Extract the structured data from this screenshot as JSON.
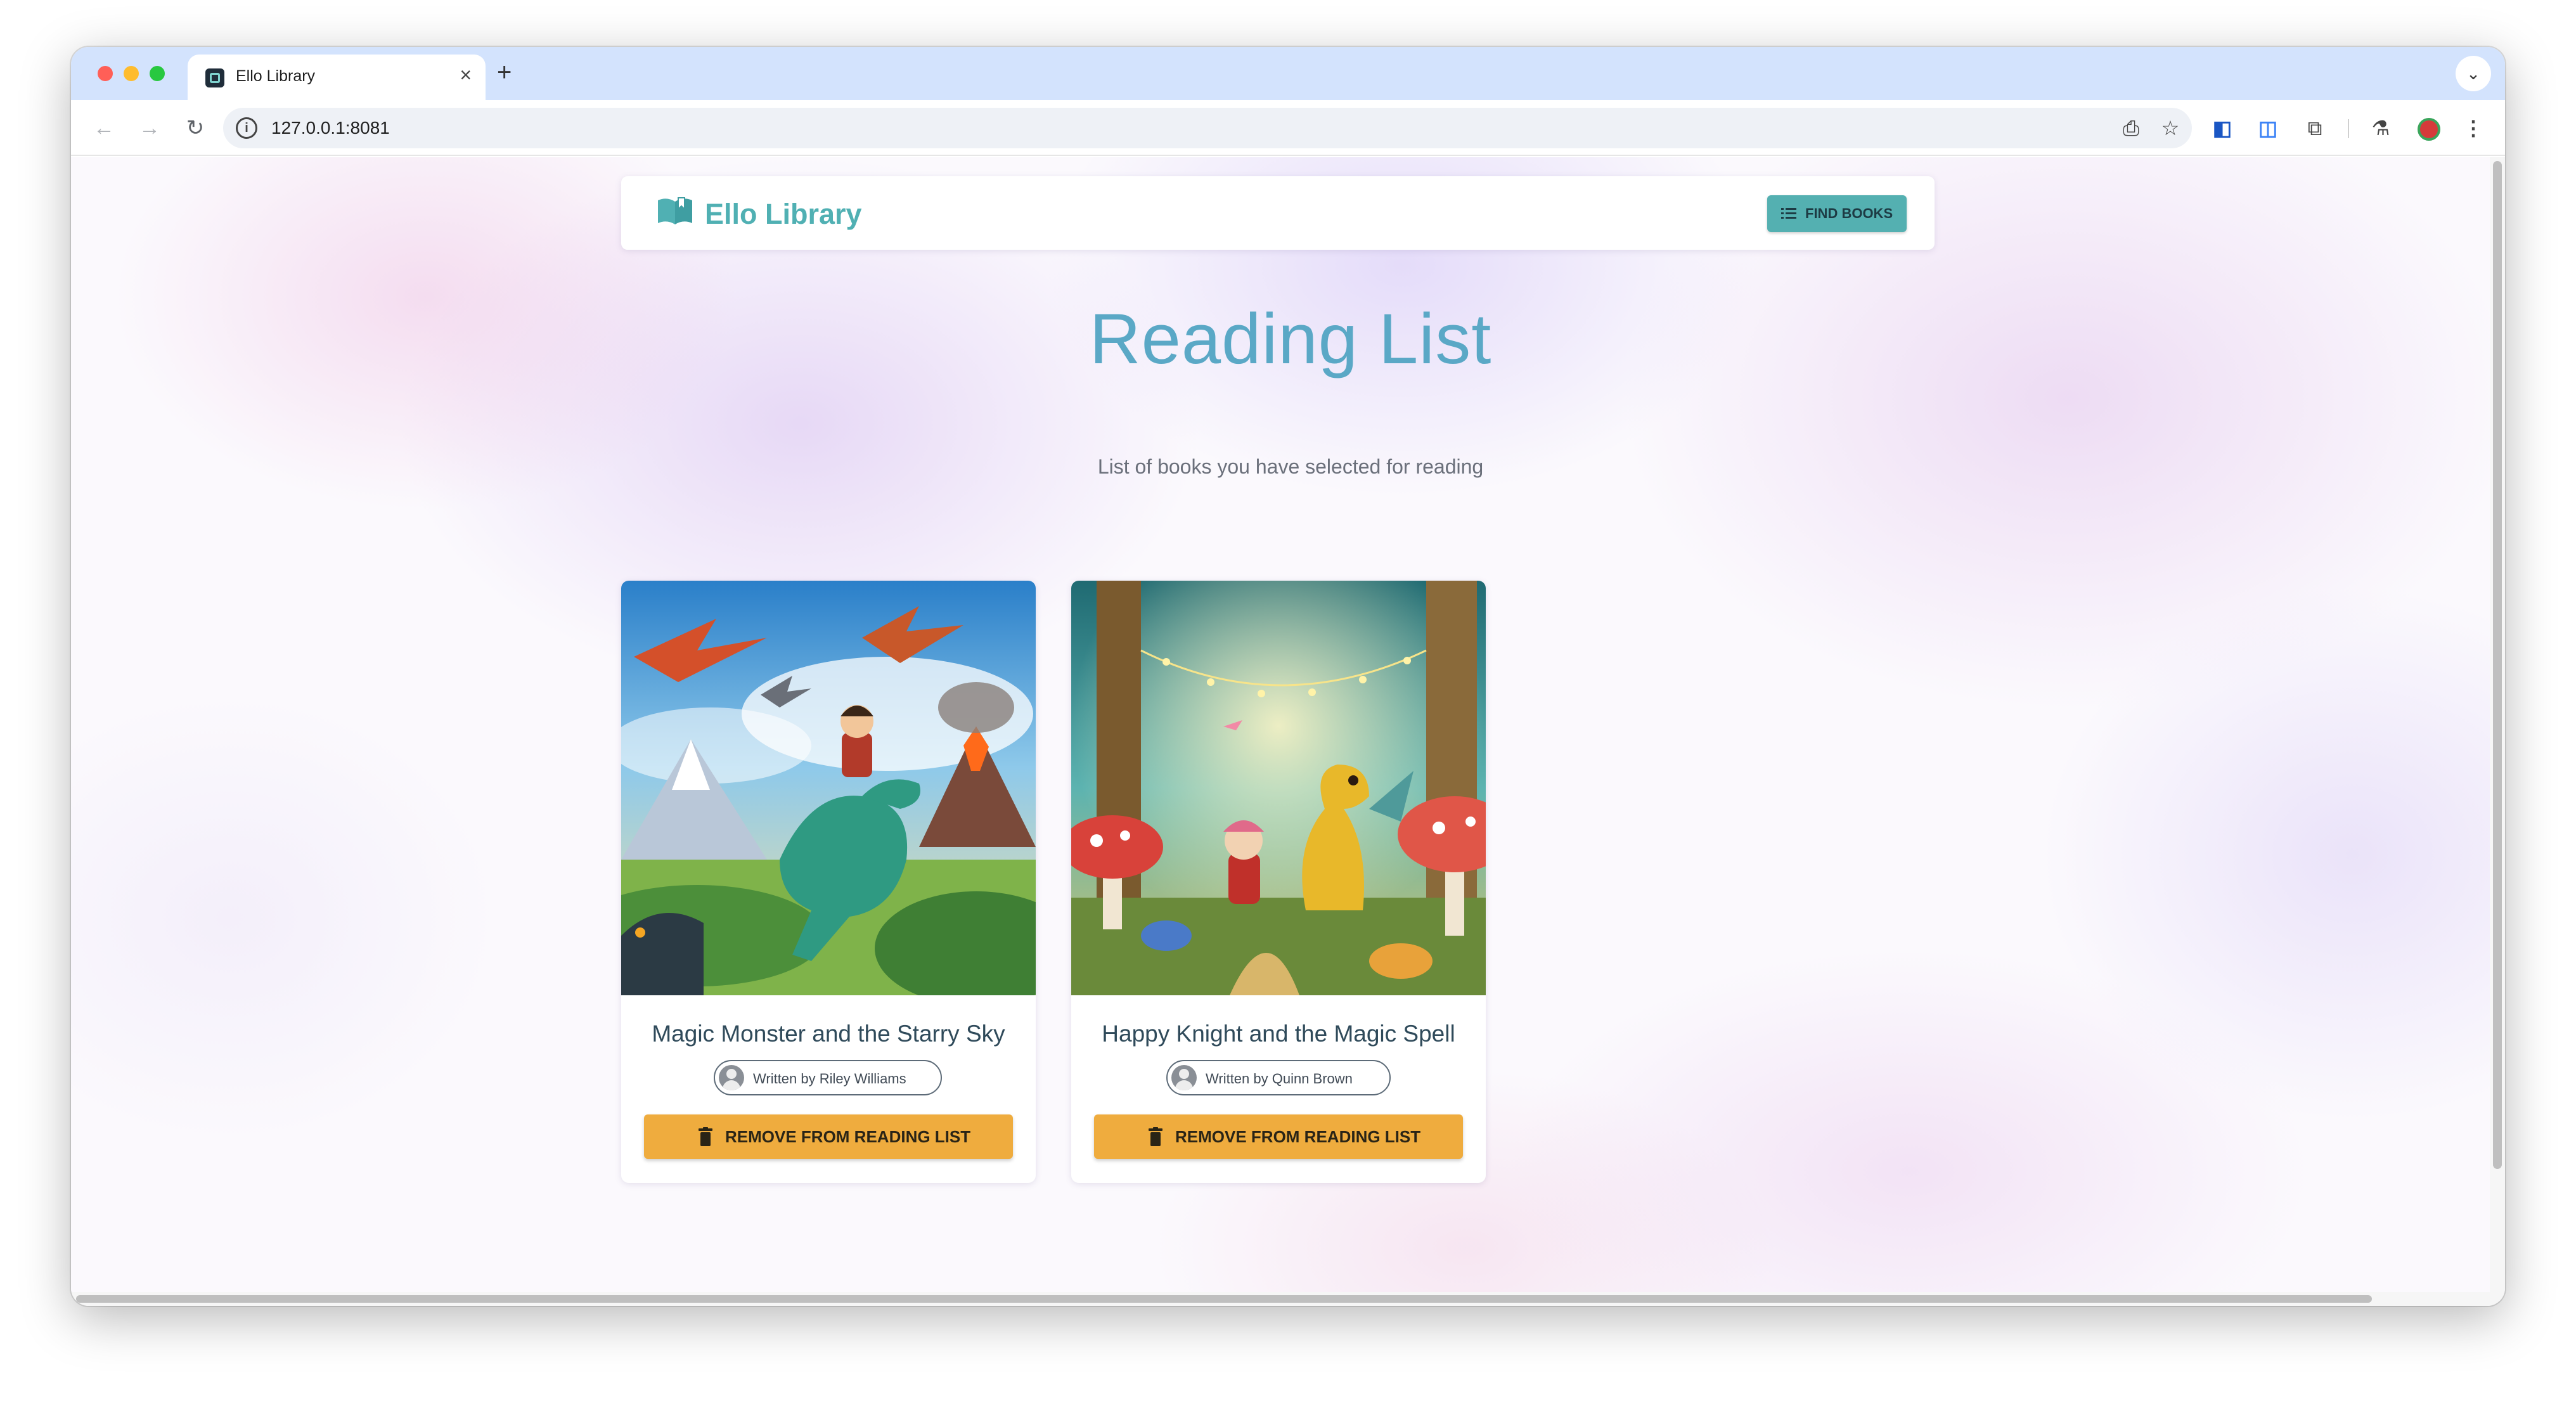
{
  "browser": {
    "tab_title": "Ello Library",
    "url": "127.0.0.1:8081"
  },
  "app": {
    "name": "Ello Library",
    "find_books_label": "FIND BOOKS",
    "brand_color": "#50b0b3",
    "accent_button_color": "#efac3e"
  },
  "page": {
    "title": "Reading List",
    "subtitle": "List of books you have selected for reading"
  },
  "books": [
    {
      "title": "Magic Monster and the Starry Sky",
      "author_line": "Written by Riley Williams",
      "action_label": "REMOVE FROM READING LIST",
      "cover": "boy-riding-dinosaur-volcano-pterodactyls"
    },
    {
      "title": "Happy Knight and the Magic Spell",
      "author_line": "Written by Quinn Brown",
      "action_label": "REMOVE FROM READING LIST",
      "cover": "girl-with-yellow-dragon-mushroom-forest"
    }
  ]
}
